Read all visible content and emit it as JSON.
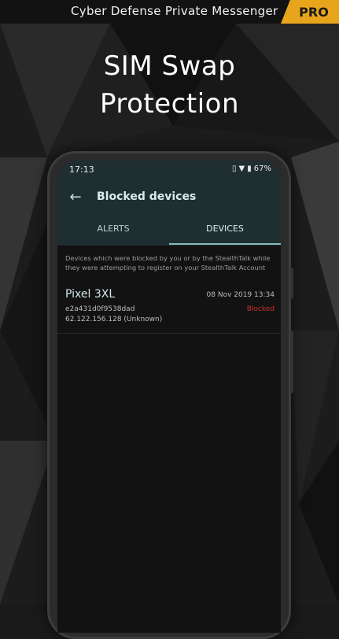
{
  "banner": {
    "title": "Cyber Defense Private Messenger",
    "badge": "PRO"
  },
  "headline": {
    "line1": "SIM Swap",
    "line2": "Protection"
  },
  "status_bar": {
    "time": "17:13",
    "battery": "67%"
  },
  "app_bar": {
    "title": "Blocked devices"
  },
  "tabs": [
    {
      "label": "ALERTS"
    },
    {
      "label": "DEVICES"
    }
  ],
  "description": "Devices which were blocked by you or by the StealthTalk while they were attempting to register on your StealthTalk Account",
  "devices": [
    {
      "name": "Pixel 3XL",
      "date": "08 Nov 2019 13:34",
      "id": "e2a431d0f9538dad",
      "status": "Blocked",
      "ip": "62.122.156.128 (Unknown)"
    }
  ],
  "colors": {
    "accent": "#e7a51c",
    "appbar": "#1f2e31",
    "blocked": "#d12c2c"
  }
}
